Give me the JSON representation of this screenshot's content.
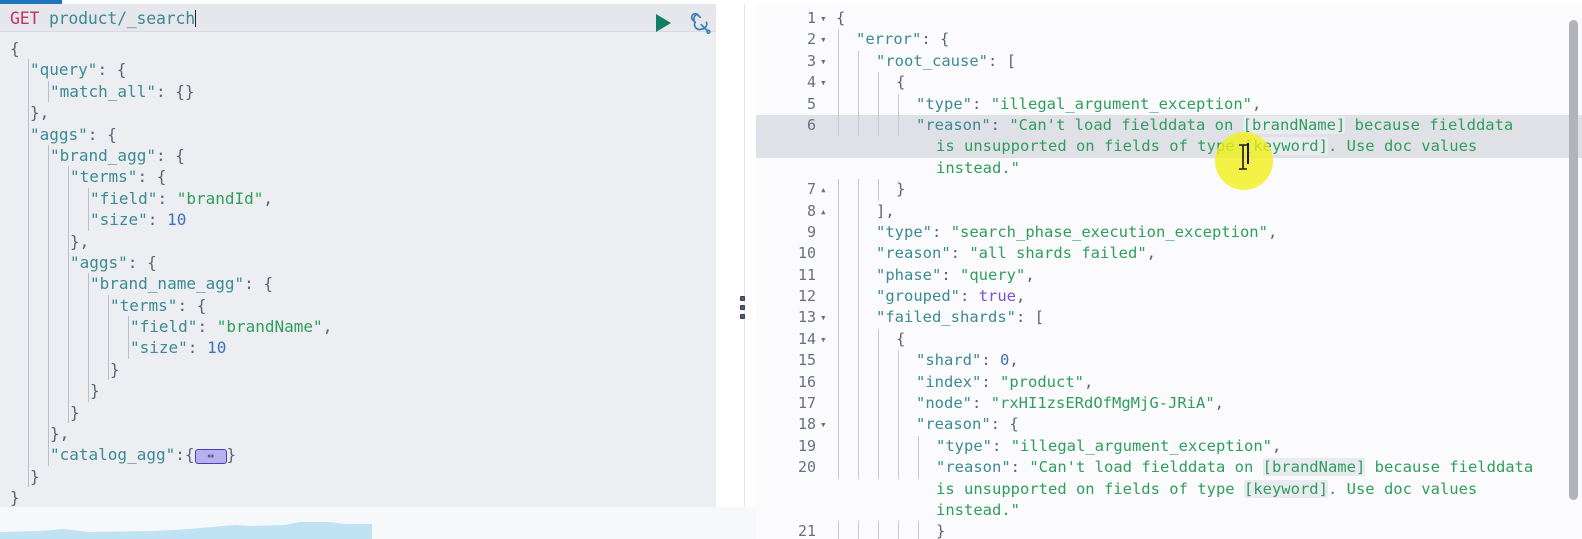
{
  "app": {
    "name": "kibana-dev-tools-console",
    "accent": "#1d74b8"
  },
  "left_panel": {
    "name": "request-editor",
    "method": "GET",
    "path": "product/_search",
    "run_label": "▶",
    "wrench_label": "wrench-icon",
    "fold_badge_label": "⇔",
    "lines": [
      {
        "indent": 0,
        "guides": 0,
        "text": "{"
      },
      {
        "indent": 1,
        "guides": 1,
        "text": "\"query\": {"
      },
      {
        "indent": 2,
        "guides": 2,
        "text": "\"match_all\": {}"
      },
      {
        "indent": 1,
        "guides": 1,
        "text": "},"
      },
      {
        "indent": 1,
        "guides": 1,
        "text": "\"aggs\": {"
      },
      {
        "indent": 2,
        "guides": 2,
        "text": "\"brand_agg\": {"
      },
      {
        "indent": 3,
        "guides": 3,
        "text": "\"terms\": {"
      },
      {
        "indent": 4,
        "guides": 4,
        "text": "\"field\": \"brandId\","
      },
      {
        "indent": 4,
        "guides": 4,
        "text": "\"size\": 10"
      },
      {
        "indent": 3,
        "guides": 3,
        "text": "},"
      },
      {
        "indent": 3,
        "guides": 3,
        "text": "\"aggs\": {"
      },
      {
        "indent": 4,
        "guides": 4,
        "text": "\"brand_name_agg\": {"
      },
      {
        "indent": 5,
        "guides": 5,
        "text": "\"terms\": {"
      },
      {
        "indent": 6,
        "guides": 6,
        "text": "\"field\": \"brandName\","
      },
      {
        "indent": 6,
        "guides": 6,
        "text": "\"size\": 10"
      },
      {
        "indent": 5,
        "guides": 5,
        "text": "}"
      },
      {
        "indent": 4,
        "guides": 4,
        "text": "}"
      },
      {
        "indent": 3,
        "guides": 3,
        "text": "}"
      },
      {
        "indent": 2,
        "guides": 2,
        "text": "},"
      },
      {
        "indent": 2,
        "guides": 2,
        "text": "\"catalog_agg\":{",
        "fold": true
      },
      {
        "indent": 1,
        "guides": 1,
        "text": "}"
      },
      {
        "indent": 0,
        "guides": 0,
        "text": "}"
      }
    ]
  },
  "right_panel": {
    "name": "response-viewer",
    "active_line": 6,
    "lines": [
      {
        "n": "1",
        "fold": "▾",
        "guides": 0,
        "text": "{"
      },
      {
        "n": "2",
        "fold": "▾",
        "guides": 1,
        "text": "\"error\": {"
      },
      {
        "n": "3",
        "fold": "▾",
        "guides": 2,
        "text": "\"root_cause\": ["
      },
      {
        "n": "4",
        "fold": "▾",
        "guides": 3,
        "text": "{"
      },
      {
        "n": "5",
        "fold": "",
        "guides": 4,
        "text": "\"type\": \"illegal_argument_exception\","
      },
      {
        "n": "6",
        "fold": "",
        "guides": 4,
        "text": "\"reason\": \"Can't load fielddata on [brandName] because fielddata",
        "active": true
      },
      {
        "n": "",
        "fold": "",
        "guides": 0,
        "text": "is unsupported on fields of type [keyword]. Use doc values",
        "active": true,
        "wrap": true
      },
      {
        "n": "",
        "fold": "",
        "guides": 0,
        "text": "instead.\"",
        "wrap": true
      },
      {
        "n": "7",
        "fold": "▴",
        "guides": 3,
        "text": "}"
      },
      {
        "n": "8",
        "fold": "▴",
        "guides": 2,
        "text": "],"
      },
      {
        "n": "9",
        "fold": "",
        "guides": 2,
        "text": "\"type\": \"search_phase_execution_exception\","
      },
      {
        "n": "10",
        "fold": "",
        "guides": 2,
        "text": "\"reason\": \"all shards failed\","
      },
      {
        "n": "11",
        "fold": "",
        "guides": 2,
        "text": "\"phase\": \"query\","
      },
      {
        "n": "12",
        "fold": "",
        "guides": 2,
        "text": "\"grouped\": true,"
      },
      {
        "n": "13",
        "fold": "▾",
        "guides": 2,
        "text": "\"failed_shards\": ["
      },
      {
        "n": "14",
        "fold": "▾",
        "guides": 3,
        "text": "{"
      },
      {
        "n": "15",
        "fold": "",
        "guides": 4,
        "text": "\"shard\": 0,"
      },
      {
        "n": "16",
        "fold": "",
        "guides": 4,
        "text": "\"index\": \"product\","
      },
      {
        "n": "17",
        "fold": "",
        "guides": 4,
        "text": "\"node\": \"rxHI1zsERdOfMgMjG-JRiA\","
      },
      {
        "n": "18",
        "fold": "▾",
        "guides": 4,
        "text": "\"reason\": {"
      },
      {
        "n": "19",
        "fold": "",
        "guides": 5,
        "text": "\"type\": \"illegal_argument_exception\","
      },
      {
        "n": "20",
        "fold": "",
        "guides": 5,
        "text": "\"reason\": \"Can't load fielddata on [brandName] because fielddata"
      },
      {
        "n": "",
        "fold": "",
        "guides": 0,
        "text": "is unsupported on fields of type [keyword]. Use doc values",
        "wrap": true
      },
      {
        "n": "",
        "fold": "",
        "guides": 0,
        "text": "instead.\"",
        "wrap": true
      },
      {
        "n": "21",
        "fold": "",
        "guides": 5,
        "text": "}"
      }
    ]
  },
  "colors": {
    "method": "#c4315e",
    "key": "#3b8a94",
    "string": "#2f9e5c",
    "number": "#3f6fbe",
    "boolean": "#7a4fd6",
    "active_line_bg": "#dfe1e6",
    "cursor_highlight": "#f2ef12",
    "editor_bg": "#eceef2",
    "response_bg": "#fbfbfd"
  }
}
